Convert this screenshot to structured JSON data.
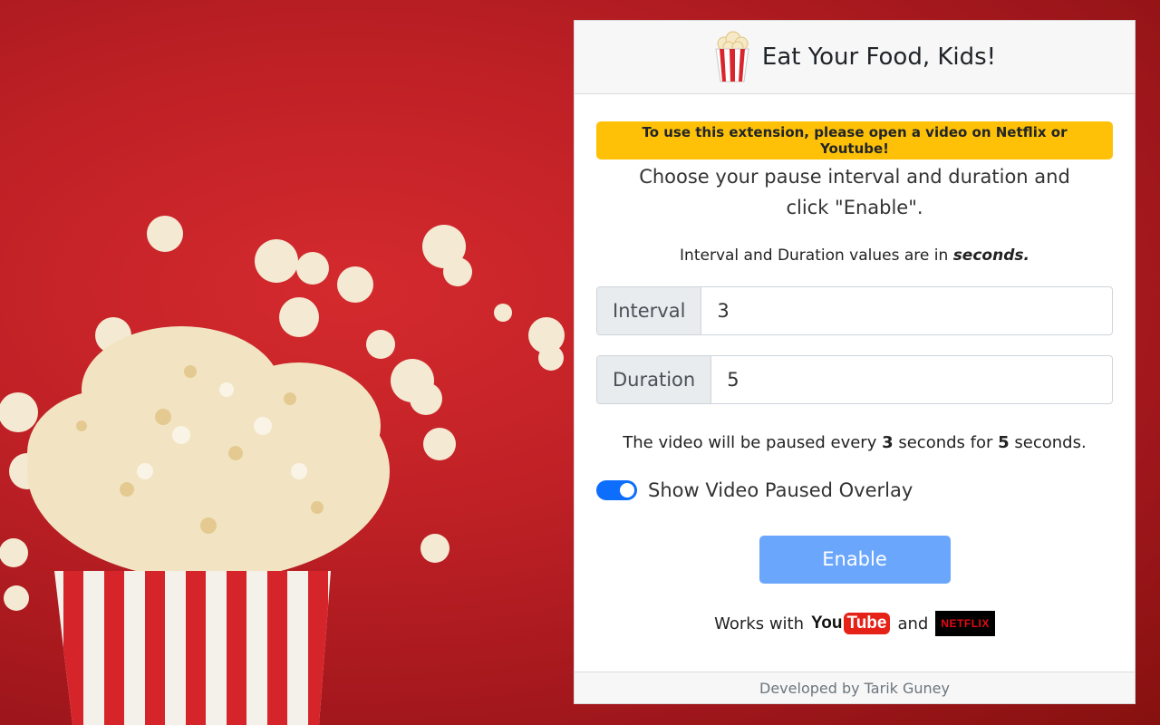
{
  "header": {
    "title": "Eat Your Food, Kids!",
    "logo_icon": "popcorn-icon"
  },
  "notice": "To use this extension, please open a video on Netflix or Youtube!",
  "instruction": "Choose your pause interval and duration and click \"Enable\".",
  "units": {
    "prefix": "Interval and Duration values are in",
    "unit": "seconds."
  },
  "fields": {
    "interval": {
      "label": "Interval",
      "value": "3"
    },
    "duration": {
      "label": "Duration",
      "value": "5"
    }
  },
  "summary": {
    "part1": "The video will be paused every",
    "interval": "3",
    "part2": "seconds for",
    "duration": "5",
    "part3": "seconds."
  },
  "overlay_toggle": {
    "label": "Show Video Paused Overlay",
    "checked": true
  },
  "enable_button": "Enable",
  "works_with": {
    "prefix": "Works with",
    "youtube_you": "You",
    "youtube_tube": "Tube",
    "and": "and",
    "netflix": "NETFLIX"
  },
  "footer": "Developed by Tarik Guney",
  "colors": {
    "notice_bg": "#ffc107",
    "toggle_on": "#0d6efd",
    "button_bg": "#6aa6fb",
    "background": "#b81e24"
  }
}
